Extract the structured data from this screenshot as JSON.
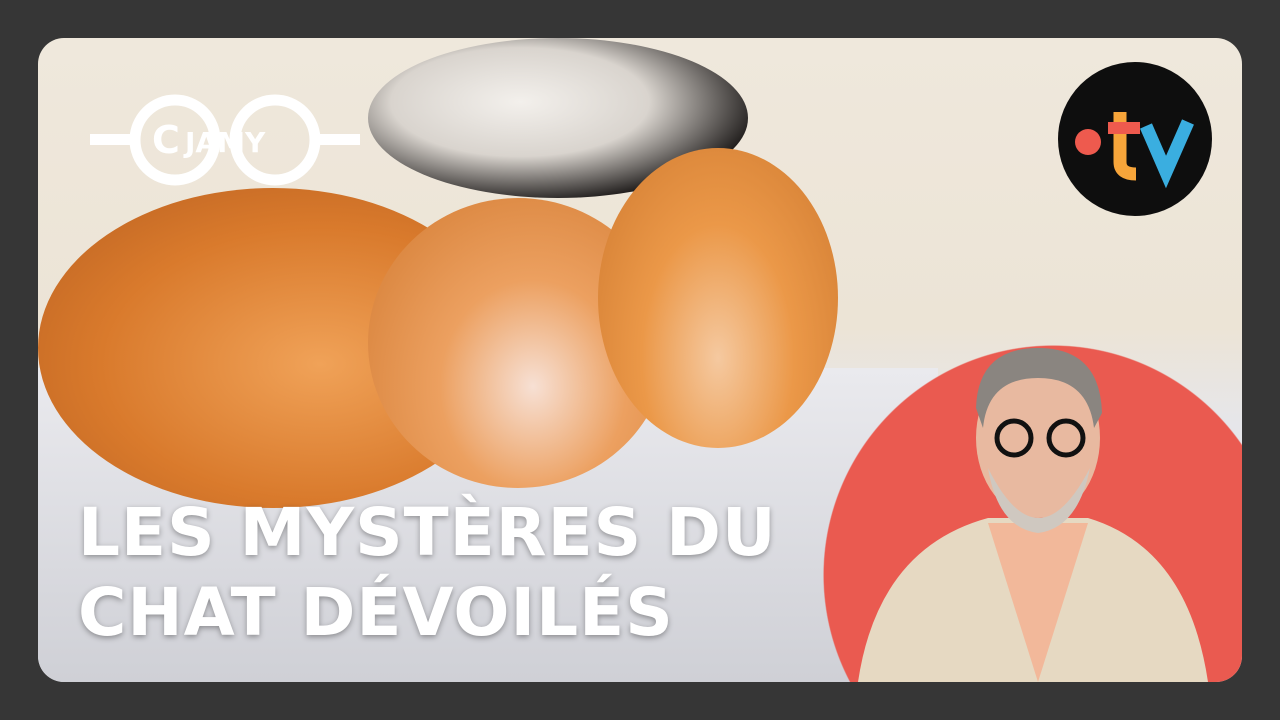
{
  "title": {
    "line1": "LES MYSTÈRES DU",
    "line2": "CHAT DÉVOILÉS"
  },
  "logos": {
    "left": "JAMY",
    "right": ".tv"
  },
  "colors": {
    "frame": "#363636",
    "accent": "#ea5a50",
    "tv_red": "#ee5a4e",
    "tv_orange": "#f7a53a",
    "tv_blue": "#3aaee0"
  }
}
